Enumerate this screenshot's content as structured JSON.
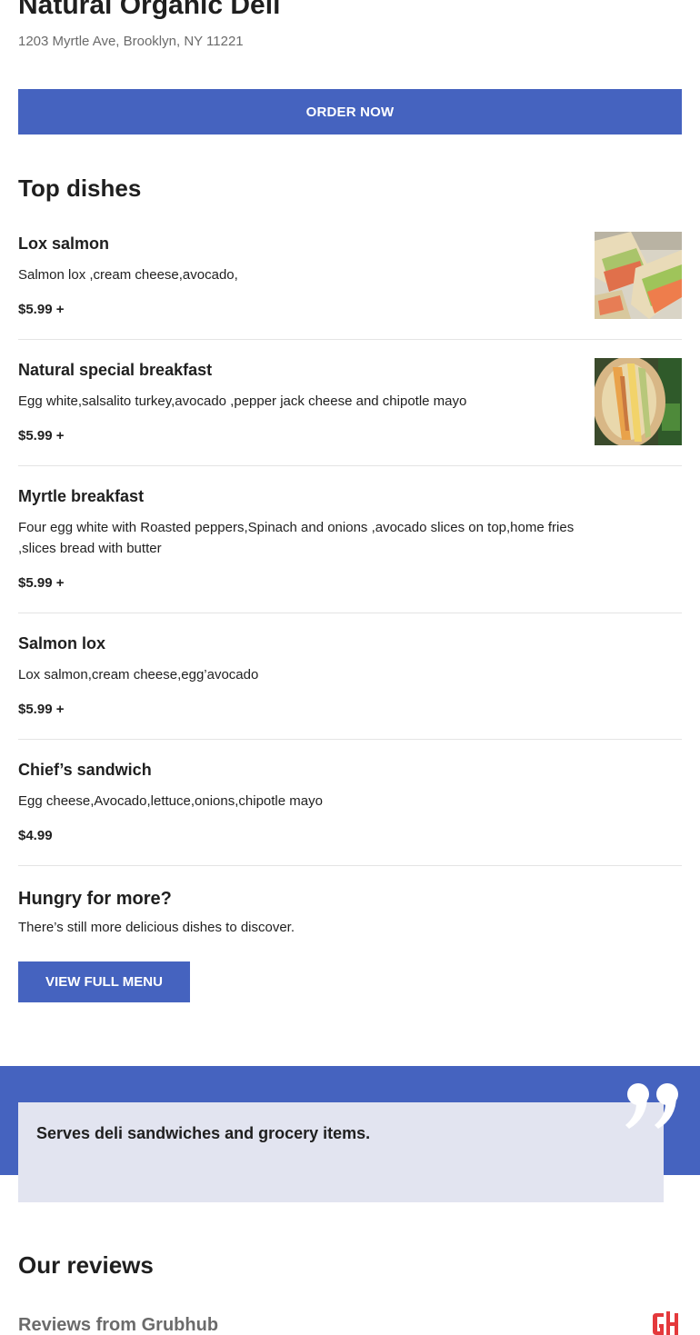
{
  "restaurant": {
    "name": "Natural Organic Deli",
    "address": "1203 Myrtle Ave, Brooklyn, NY 11221"
  },
  "order_button": "ORDER NOW",
  "top_dishes": {
    "title": "Top dishes",
    "items": [
      {
        "name": "Lox salmon",
        "description": "Salmon lox ,cream cheese,avocado,",
        "price": "$5.99 +",
        "image": "sandwich-photo"
      },
      {
        "name": "Natural special breakfast",
        "description": "Egg white,salsalito turkey,avocado ,pepper jack cheese and chipotle mayo",
        "price": "$5.99 +",
        "image": "wrap-photo"
      },
      {
        "name": "Myrtle breakfast",
        "description": "Four egg white with Roasted peppers,Spinach and onions ,avocado slices on top,home fries ,slices bread with butter",
        "price": "$5.99 +"
      },
      {
        "name": "Salmon lox",
        "description": "Lox salmon,cream cheese,egg’avocado",
        "price": "$5.99 +"
      },
      {
        "name": "Chief’s sandwich",
        "description": "Egg cheese,Avocado,lettuce,onions,chipotle mayo",
        "price": "$4.99"
      }
    ]
  },
  "more": {
    "title": "Hungry for more?",
    "text": "There’s still more delicious dishes to discover.",
    "button": "VIEW FULL MENU"
  },
  "quote": {
    "text": "Serves deli sandwiches and grocery items.",
    "icon": "quote-icon"
  },
  "reviews": {
    "title": "Our reviews",
    "subtitle": "Reviews from Grubhub",
    "logo": "grubhub-logo"
  },
  "colors": {
    "accent": "#4563bf",
    "quote_bg": "#e2e4f0",
    "grubhub_red": "#e4393c"
  }
}
